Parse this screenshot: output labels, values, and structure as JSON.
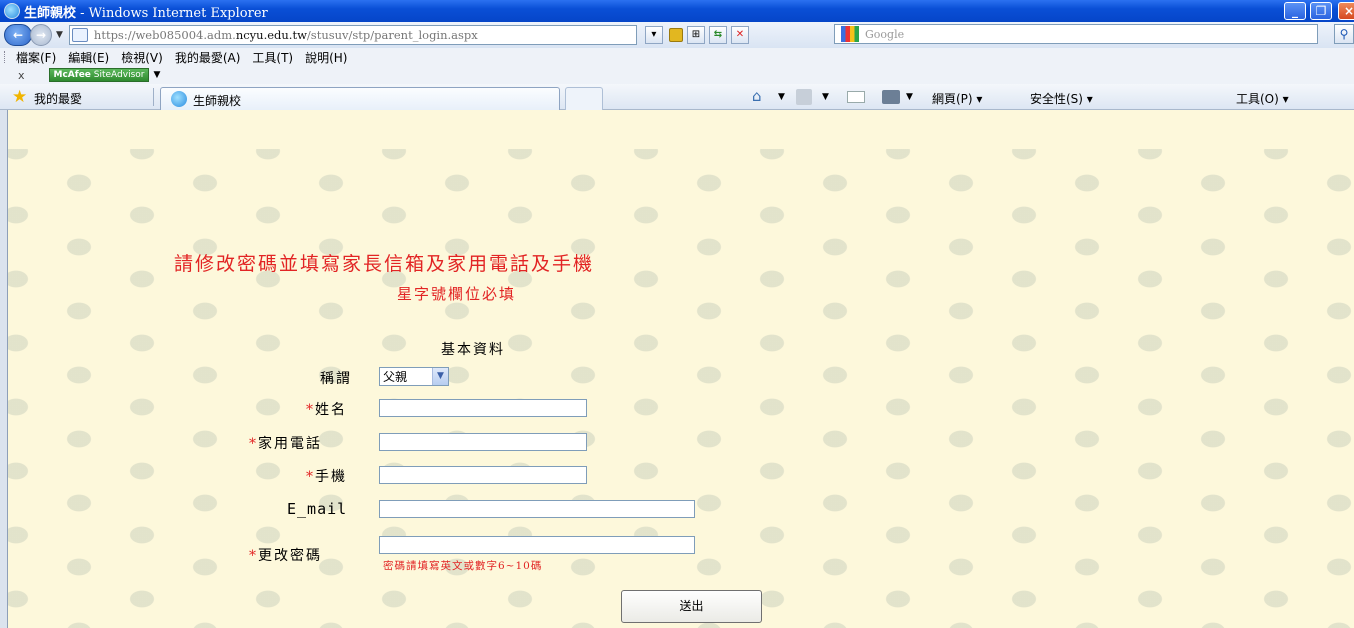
{
  "window": {
    "title_page": "生師親校",
    "title_app": " - Windows Internet Explorer",
    "minimize_glyph": "_",
    "maximize_glyph": "❐",
    "close_glyph": "×"
  },
  "address_bar": {
    "url_prefix": "https://web085004.adm.",
    "url_domain": "ncyu.edu.tw",
    "url_path": "/stusuv/stp/parent_login.aspx",
    "search_placeholder": "Google"
  },
  "menu": {
    "items": [
      "檔案(F)",
      "編輯(E)",
      "檢視(V)",
      "我的最愛(A)",
      "工具(T)",
      "說明(H)"
    ]
  },
  "mcafee": {
    "close_glyph": "x",
    "badge_brand": "McAfee",
    "badge_text": " SiteAdvisor"
  },
  "favorites_bar": {
    "favorites_label": "我的最愛",
    "tab_label": "生師親校",
    "commands": [
      "網頁(P)",
      "安全性(S)",
      "工具(O)"
    ]
  },
  "form": {
    "heading": "請修改密碼並填寫家長信箱及家用電話及手機",
    "subheading": "星字號欄位必填",
    "section_title": "基本資料",
    "required_marker": "*",
    "title_label": "稱謂",
    "title_value": "父親",
    "name_label": "姓名",
    "name_value": "",
    "home_phone_label": "家用電話",
    "home_phone_value": "",
    "mobile_label": "手機",
    "mobile_value": "",
    "email_label": "E_mail",
    "email_value": "",
    "password_label": "更改密碼",
    "password_value": "",
    "password_hint": "密碼請填寫英文或數字6~10碼",
    "submit_label": "送出"
  },
  "colors": {
    "required_red": "#e22424",
    "page_background": "#fdf8db",
    "titlebar_blue": "#0545c8"
  }
}
